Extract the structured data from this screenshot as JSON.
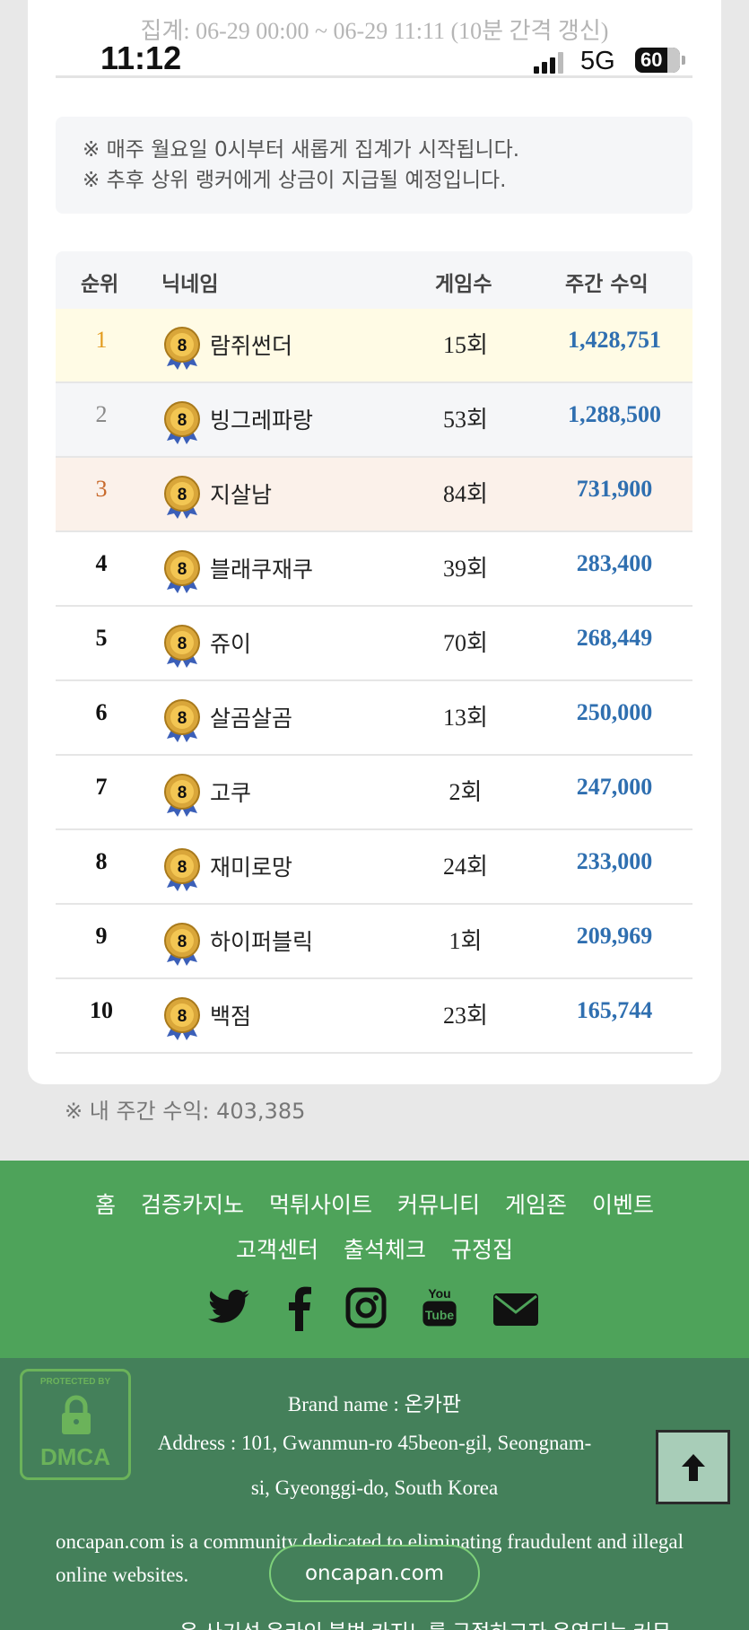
{
  "status": {
    "time": "11:12",
    "network": "5G",
    "battery": "60"
  },
  "aggregation": "집계: 06-29 00:00 ~ 06-29 11:11 (10분 간격 갱신)",
  "notices": [
    "※ 매주 월요일 0시부터 새롭게 집계가 시작됩니다.",
    "※ 추후 상위 랭커에게 상금이 지급될 예정입니다."
  ],
  "table": {
    "headers": {
      "rank": "순위",
      "nickname": "닉네임",
      "games": "게임수",
      "earnings": "주간 수익"
    },
    "rows": [
      {
        "rank": "1",
        "nickname": "람쥐썬더",
        "games": "15회",
        "earnings": "1,428,751"
      },
      {
        "rank": "2",
        "nickname": "빙그레파랑",
        "games": "53회",
        "earnings": "1,288,500"
      },
      {
        "rank": "3",
        "nickname": "지살남",
        "games": "84회",
        "earnings": "731,900"
      },
      {
        "rank": "4",
        "nickname": "블래쿠재쿠",
        "games": "39회",
        "earnings": "283,400"
      },
      {
        "rank": "5",
        "nickname": "쥬이",
        "games": "70회",
        "earnings": "268,449"
      },
      {
        "rank": "6",
        "nickname": "살곰살곰",
        "games": "13회",
        "earnings": "250,000"
      },
      {
        "rank": "7",
        "nickname": "고쿠",
        "games": "2회",
        "earnings": "247,000"
      },
      {
        "rank": "8",
        "nickname": "재미로망",
        "games": "24회",
        "earnings": "233,000"
      },
      {
        "rank": "9",
        "nickname": "하이퍼블릭",
        "games": "1회",
        "earnings": "209,969"
      },
      {
        "rank": "10",
        "nickname": "백점",
        "games": "23회",
        "earnings": "165,744"
      }
    ],
    "level_badge": "8"
  },
  "my_earnings": "※ 내 주간 수익: 403,385",
  "footer_nav": {
    "row1": [
      "홈",
      "검증카지노",
      "먹튀사이트",
      "커뮤니티",
      "게임존",
      "이벤트"
    ],
    "row2": [
      "고객센터",
      "출석체크",
      "규정집"
    ]
  },
  "social_icons": [
    "twitter-icon",
    "facebook-icon",
    "instagram-icon",
    "youtube-icon",
    "mail-icon"
  ],
  "footer": {
    "brand": "Brand name : 온카판",
    "address1": "Address : 101, Gwanmun-ro 45beon-gil, Seongnam-",
    "address2": "si, Gyeonggi-do, South Korea",
    "description": "oncapan.com is a community dedicated to eliminating fraudulent and illegal online websites.",
    "pill": "oncapan.com",
    "cutoff": "온 사기성 온라인 불법 카지노를 근절하고자 운영되는 커뮤"
  },
  "dmca": {
    "top": "PROTECTED BY",
    "bottom": "DMCA"
  }
}
